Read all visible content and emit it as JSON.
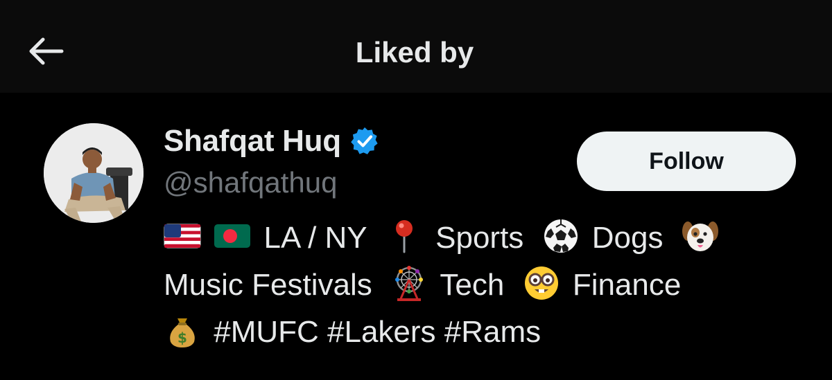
{
  "header": {
    "title": "Liked by",
    "back_icon": "arrow-left-icon"
  },
  "user": {
    "display_name": "Shafqat Huq",
    "handle": "@shafqathuq",
    "verified": true,
    "verified_icon": "verified-badge-icon",
    "follow_label": "Follow",
    "bio": {
      "line1": {
        "text1": "LA / NY",
        "text2": "Sports",
        "text3": "Dogs"
      },
      "line2": {
        "text1": "Music Festivals",
        "text2": "Tech",
        "text3": "Finance"
      },
      "line3": {
        "text1": "#MUFC #Lakers #Rams"
      },
      "emojis": [
        "us-flag-icon",
        "bangladesh-flag-icon",
        "round-pushpin-icon",
        "soccer-ball-icon",
        "dog-face-icon",
        "ferris-wheel-icon",
        "nerd-face-icon",
        "money-bag-icon"
      ]
    }
  },
  "colors": {
    "background": "#000000",
    "header_bg": "#0b0b0b",
    "primary_text": "#e7e9ea",
    "secondary_text": "#71767b",
    "verified_blue": "#1d9bf0",
    "follow_bg": "#eff3f4"
  }
}
